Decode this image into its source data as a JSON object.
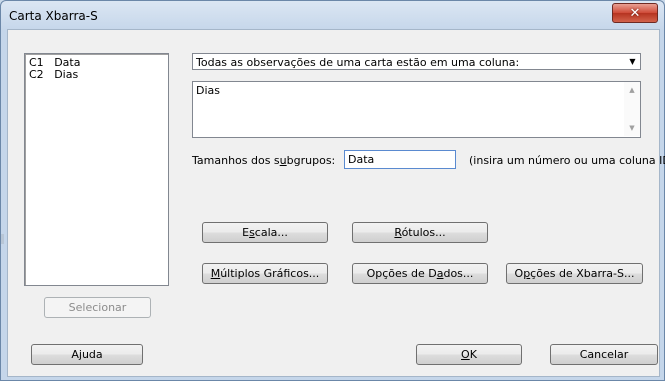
{
  "window": {
    "title": "Carta Xbarra-S",
    "close_glyph": "✕"
  },
  "variables": [
    {
      "id": "C1",
      "name": "Data"
    },
    {
      "id": "C2",
      "name": "Dias"
    }
  ],
  "layout_select": {
    "value": "Todas as observações de uma carta estão em uma coluna:"
  },
  "columns_box": {
    "value": "Dias"
  },
  "subgroup": {
    "label_pre": "Tamanhos dos s",
    "label_ul": "u",
    "label_post": "bgrupos:",
    "value": "Data",
    "hint": "(insira um número ou uma coluna ID)"
  },
  "buttons": {
    "escala": {
      "pre": "E",
      "ul": "s",
      "post": "cala..."
    },
    "rotulos": {
      "pre": "",
      "ul": "R",
      "post": "ótulos..."
    },
    "multiplos": {
      "pre": "",
      "ul": "M",
      "post": "últiplos Gráficos..."
    },
    "opcoes_dados": {
      "pre": "Opções de D",
      "ul": "a",
      "post": "dos..."
    },
    "opcoes_xbarra": {
      "pre": "O",
      "ul": "p",
      "post": "ções de Xbarra-S..."
    },
    "selecionar": "Selecionar",
    "ajuda": "Ajuda",
    "ok": {
      "pre": "",
      "ul": "O",
      "post": "K"
    },
    "cancelar": "Cancelar"
  },
  "icons": {
    "dropdown": "chevron-down-icon",
    "scroll_up": "scroll-up-icon",
    "scroll_down": "scroll-down-icon"
  }
}
